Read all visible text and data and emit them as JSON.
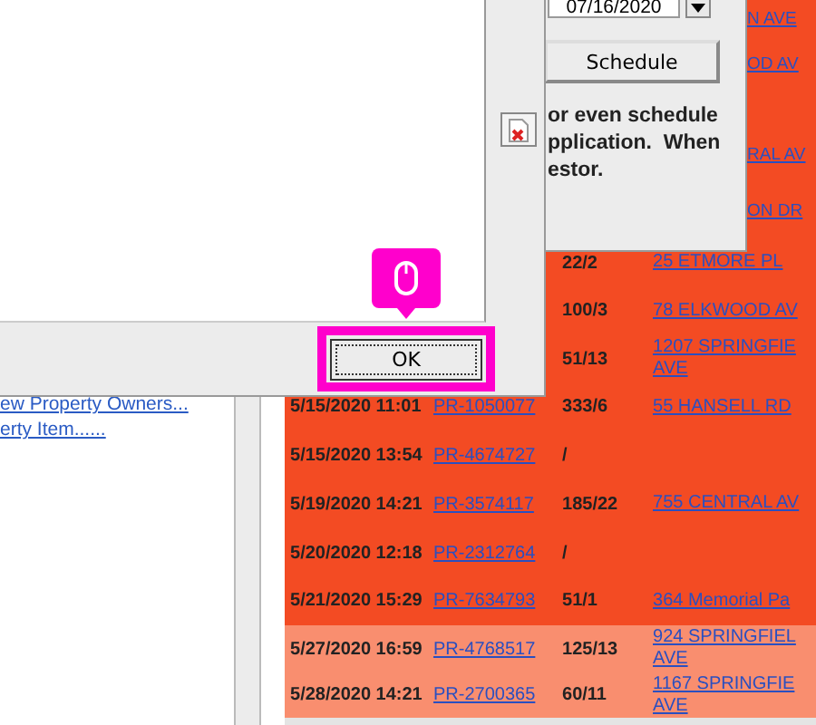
{
  "dialog": {
    "ok_button": {
      "label": "OK",
      "highlighted": true
    }
  },
  "back_window": {
    "date_field": {
      "value": "07/16/2020"
    },
    "schedule_button": {
      "label": "Schedule"
    },
    "message_lines": [
      "or even schedule",
      "pplication.  When",
      "estor."
    ]
  },
  "left_pane": {
    "links": [
      "ew Property Owners...",
      "erty Item......"
    ]
  },
  "table": {
    "rows": [
      {
        "kind": "partial",
        "color": "#f34b23",
        "address": "N AVE"
      },
      {
        "kind": "partial",
        "color": "#f34b23",
        "address": "OD AV"
      },
      {
        "kind": "partial",
        "color": "#f34b23",
        "address": "RAL AV"
      },
      {
        "kind": "partial",
        "color": "#f34b23",
        "address": "ON DR"
      },
      {
        "kind": "full",
        "color": "#f34b23",
        "parcel": "22/2",
        "address": "25 ETMORE PL"
      },
      {
        "kind": "full",
        "color": "#f34b23",
        "parcel": "100/3",
        "address": "78 ELKWOOD AV"
      },
      {
        "kind": "full",
        "color": "#f34b23",
        "parcel": "51/13",
        "address": "1207 SPRINGFIE AVE"
      },
      {
        "kind": "full",
        "color": "#f34b23",
        "date": "5/15/2020 11:01",
        "permit": "PR-1050077",
        "parcel": "333/6",
        "address": "55 HANSELL RD"
      },
      {
        "kind": "full",
        "color": "#f34b23",
        "date": "5/15/2020 13:54",
        "permit": "PR-4674727",
        "parcel": "/"
      },
      {
        "kind": "full",
        "color": "#f34b23",
        "date": "5/19/2020 14:21",
        "permit": "PR-3574117",
        "parcel": "185/22",
        "address": "755 CENTRAL AV"
      },
      {
        "kind": "full",
        "color": "#f34b23",
        "date": "5/20/2020 12:18",
        "permit": "PR-2312764",
        "parcel": "/"
      },
      {
        "kind": "full",
        "color": "#f34b23",
        "date": "5/21/2020 15:29",
        "permit": "PR-7634793",
        "parcel": "51/1",
        "address": "364 Memorial Pa"
      },
      {
        "kind": "full",
        "color": "#f98e6f",
        "date": "5/27/2020 16:59",
        "permit": "PR-4768517",
        "parcel": "125/13",
        "address": "924 SPRINGFIEL AVE"
      },
      {
        "kind": "full",
        "color": "#f98e6f",
        "date": "5/28/2020 14:21",
        "permit": "PR-2700365",
        "parcel": "60/11",
        "address": "1167 SPRINGFIE AVE"
      }
    ]
  }
}
